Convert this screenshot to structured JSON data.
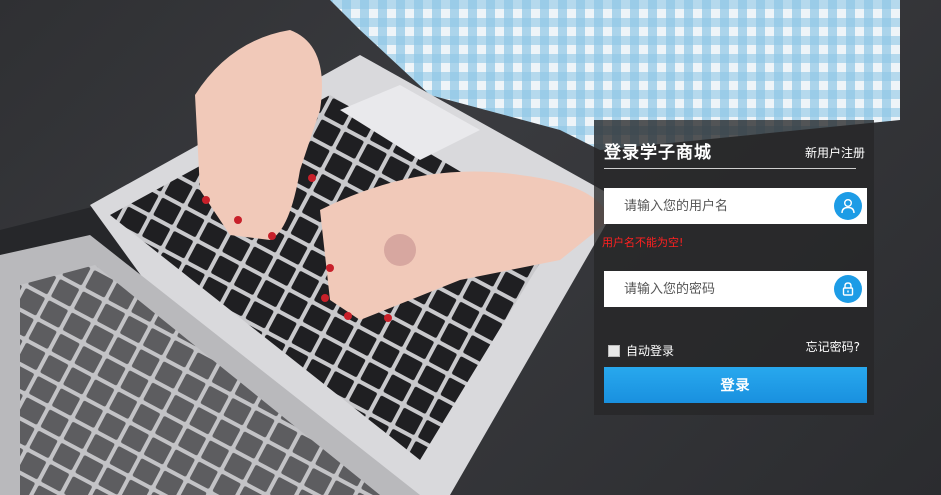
{
  "login": {
    "title": "登录学子商城",
    "register_link": "新用户注册",
    "username_placeholder": "请输入您的用户名",
    "username_error": "用户名不能为空!",
    "password_placeholder": "请输入您的密码",
    "remember_label": "自动登录",
    "forgot_link": "忘记密码?",
    "submit_label": "登录"
  },
  "colors": {
    "accent": "#1d9ce6",
    "error": "#ff2020",
    "panel": "#262628"
  },
  "icons": {
    "username": "user-icon",
    "password": "lock-icon"
  }
}
